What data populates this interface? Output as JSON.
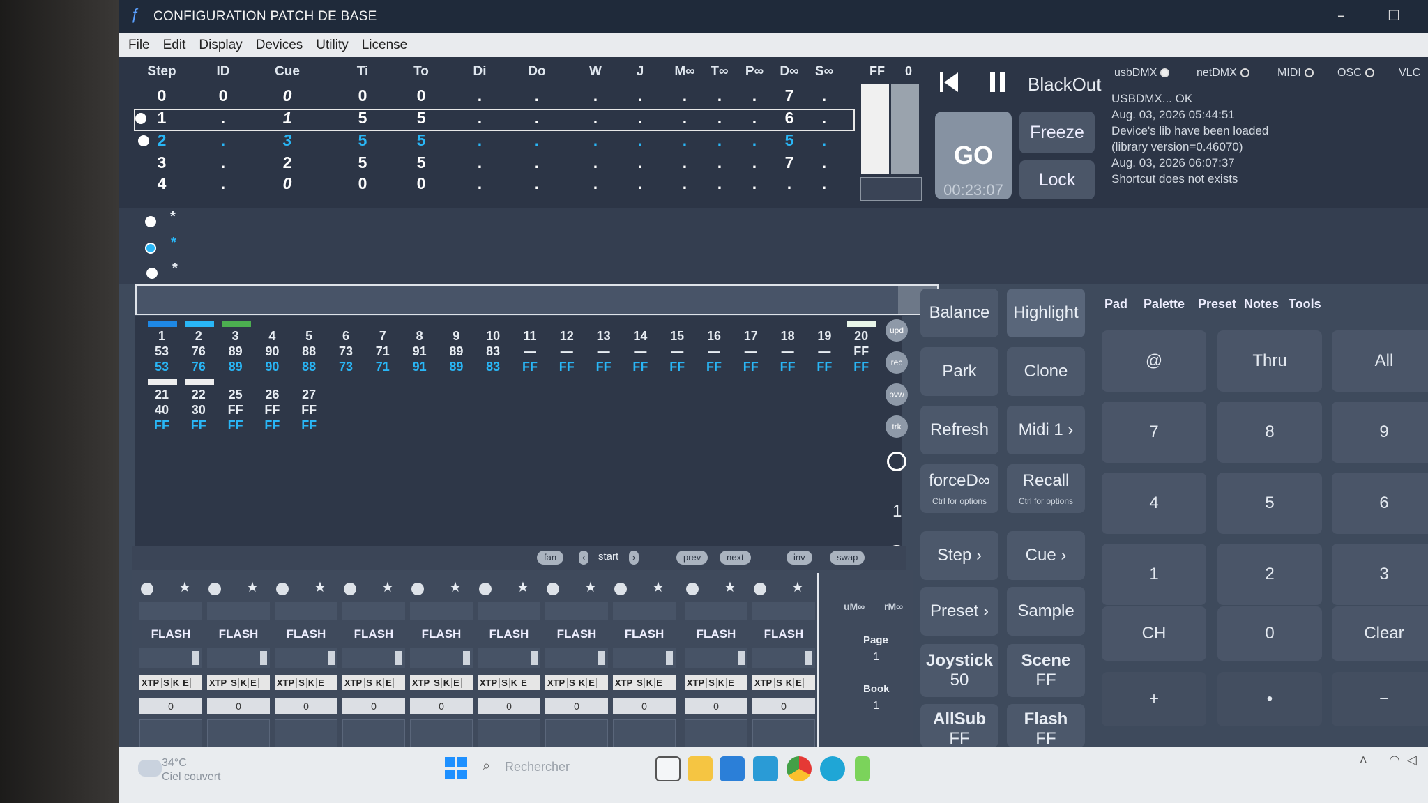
{
  "window": {
    "title": "CONFIGURATION PATCH DE BASE",
    "min": "–",
    "max": "☐"
  },
  "menu": [
    "File",
    "Edit",
    "Display",
    "Devices",
    "Utility",
    "License"
  ],
  "seq": {
    "headers": [
      "Step",
      "ID",
      "Cue",
      "Ti",
      "To",
      "Di",
      "Do",
      "W",
      "J",
      "M∞",
      "T∞",
      "P∞",
      "D∞",
      "S∞"
    ],
    "rows": [
      {
        "cells": [
          "0",
          "0",
          "0",
          "0",
          "0",
          ".",
          ".",
          ".",
          ".",
          ".",
          ".",
          ".",
          "7",
          "."
        ],
        "color": "#ffffff"
      },
      {
        "cells": [
          "1",
          ".",
          "1",
          "5",
          "5",
          ".",
          ".",
          ".",
          ".",
          ".",
          ".",
          ".",
          "6",
          "."
        ],
        "color": "#ffffff"
      },
      {
        "cells": [
          "2",
          ".",
          "3",
          "5",
          "5",
          ".",
          ".",
          ".",
          ".",
          ".",
          ".",
          ".",
          "5",
          "."
        ],
        "color": "#29b6f6"
      },
      {
        "cells": [
          "3",
          ".",
          "2",
          "5",
          "5",
          ".",
          ".",
          ".",
          ".",
          ".",
          ".",
          ".",
          "7",
          "."
        ],
        "color": "#ffffff"
      },
      {
        "cells": [
          "4",
          ".",
          "0",
          "0",
          "0",
          ".",
          ".",
          ".",
          ".",
          ".",
          ".",
          ".",
          ".",
          "."
        ],
        "color": "#ffffff"
      }
    ],
    "ff_label": "FF",
    "ff_value": "0"
  },
  "transport": {
    "go": "GO",
    "time": "00:23:07",
    "blackout": "BlackOut",
    "freeze": "Freeze",
    "lock": "Lock"
  },
  "status": {
    "usbdmx": "usbDMX",
    "netdmx": "netDMX",
    "midi": "MIDI",
    "osc": "OSC",
    "vlc": "VLC",
    "log": [
      "USBDMX... OK",
      "Aug. 03, 2026 05:44:51",
      "Device's lib have been loaded",
      "(library version=0.46070)",
      "Aug. 03, 2026 06:07:37",
      "Shortcut does not exists"
    ]
  },
  "stars": [
    "*",
    "*",
    "*"
  ],
  "channels": [
    {
      "n": "1",
      "v": "53",
      "w": "53",
      "sw": "#1e88e5"
    },
    {
      "n": "2",
      "v": "76",
      "w": "76",
      "sw": "#29b6f6"
    },
    {
      "n": "3",
      "v": "89",
      "w": "89",
      "sw": "#4caf50"
    },
    {
      "n": "4",
      "v": "90",
      "w": "90"
    },
    {
      "n": "5",
      "v": "88",
      "w": "88"
    },
    {
      "n": "6",
      "v": "73",
      "w": "73"
    },
    {
      "n": "7",
      "v": "71",
      "w": "71"
    },
    {
      "n": "8",
      "v": "91",
      "w": "91"
    },
    {
      "n": "9",
      "v": "89",
      "w": "89"
    },
    {
      "n": "10",
      "v": "83",
      "w": "83"
    },
    {
      "n": "11",
      "v": "—",
      "w": "FF"
    },
    {
      "n": "12",
      "v": "—",
      "w": "FF"
    },
    {
      "n": "13",
      "v": "—",
      "w": "FF"
    },
    {
      "n": "14",
      "v": "—",
      "w": "FF"
    },
    {
      "n": "15",
      "v": "—",
      "w": "FF"
    },
    {
      "n": "16",
      "v": "—",
      "w": "FF"
    },
    {
      "n": "17",
      "v": "—",
      "w": "FF"
    },
    {
      "n": "18",
      "v": "—",
      "w": "FF"
    },
    {
      "n": "19",
      "v": "—",
      "w": "FF"
    },
    {
      "n": "20",
      "v": "FF",
      "w": "FF",
      "sw": "#e8f5e9"
    }
  ],
  "channels2": [
    {
      "n": "21",
      "v": "40",
      "w": "FF",
      "sw": "#eeeeee"
    },
    {
      "n": "22",
      "v": "30",
      "w": "FF",
      "sw": "#eeeeee"
    },
    {
      "n": "25",
      "v": "FF",
      "w": "FF"
    },
    {
      "n": "26",
      "v": "FF",
      "w": "FF"
    },
    {
      "n": "27",
      "v": "FF",
      "w": "FF"
    }
  ],
  "side_icons": [
    "upd",
    "rec",
    "ovw",
    "trk"
  ],
  "page_num": "1",
  "right_buttons": {
    "balance": "Balance",
    "highlight": "Highlight",
    "park": "Park",
    "clone": "Clone",
    "refresh": "Refresh",
    "midi": "Midi 1 ›",
    "forced": "forceD∞",
    "forced_sub": "Ctrl for options",
    "recall": "Recall",
    "recall_sub": "Ctrl for options",
    "step": "Step ›",
    "cue": "Cue ›",
    "preset": "Preset ›",
    "sample": "Sample",
    "joystick": "Joystick",
    "joystick_val": "50",
    "scene": "Scene",
    "scene_val": "FF",
    "allsub": "AllSub",
    "allsub_val": "FF",
    "flash": "Flash",
    "flash_val": "FF"
  },
  "tabs": [
    "Pad",
    "Palette",
    "Preset",
    "Notes",
    "Tools"
  ],
  "keys": [
    [
      "@",
      "Thru",
      "All"
    ],
    [
      "7",
      "8",
      "9"
    ],
    [
      "4",
      "5",
      "6"
    ],
    [
      "1",
      "2",
      "3"
    ],
    [
      "CH",
      "0",
      "Clear"
    ],
    [
      "+",
      "•",
      "−"
    ]
  ],
  "subbar": {
    "fan": "fan",
    "start": "start",
    "prev": "prev",
    "next": "next",
    "inv": "inv",
    "swap": "swap"
  },
  "faders": {
    "flash": "FLASH",
    "xtp": "XTP",
    "s": "S",
    "k": "K",
    "e": "E",
    "value": "0",
    "um": "uM∞",
    "rm": "rM∞",
    "page": "Page",
    "page_val": "1",
    "book": "Book",
    "book_val": "1"
  },
  "taskbar": {
    "temp": "34°C",
    "weather": "Ciel couvert",
    "search": "Rechercher"
  }
}
